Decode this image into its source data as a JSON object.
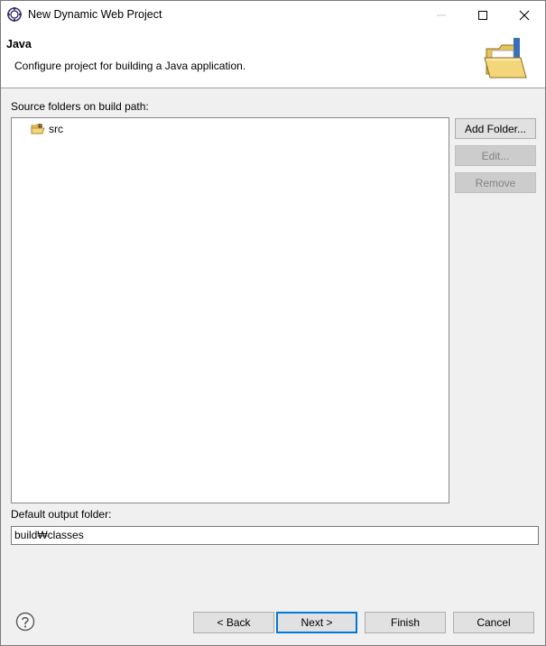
{
  "window": {
    "title": "New Dynamic Web Project"
  },
  "banner": {
    "title": "Java",
    "description": "Configure project for building a Java application."
  },
  "source": {
    "label": "Source folders on build path:",
    "items": [
      {
        "label": "src",
        "icon": "package-folder-icon"
      }
    ],
    "buttons": {
      "add_folder": "Add Folder...",
      "edit": "Edit...",
      "remove": "Remove"
    }
  },
  "output": {
    "label": "Default output folder:",
    "value": "build₩classes"
  },
  "footer": {
    "back": "< Back",
    "next": "Next >",
    "finish": "Finish",
    "cancel": "Cancel"
  },
  "colors": {
    "accent": "#0078d7",
    "window_border": "#7a7a7a"
  }
}
